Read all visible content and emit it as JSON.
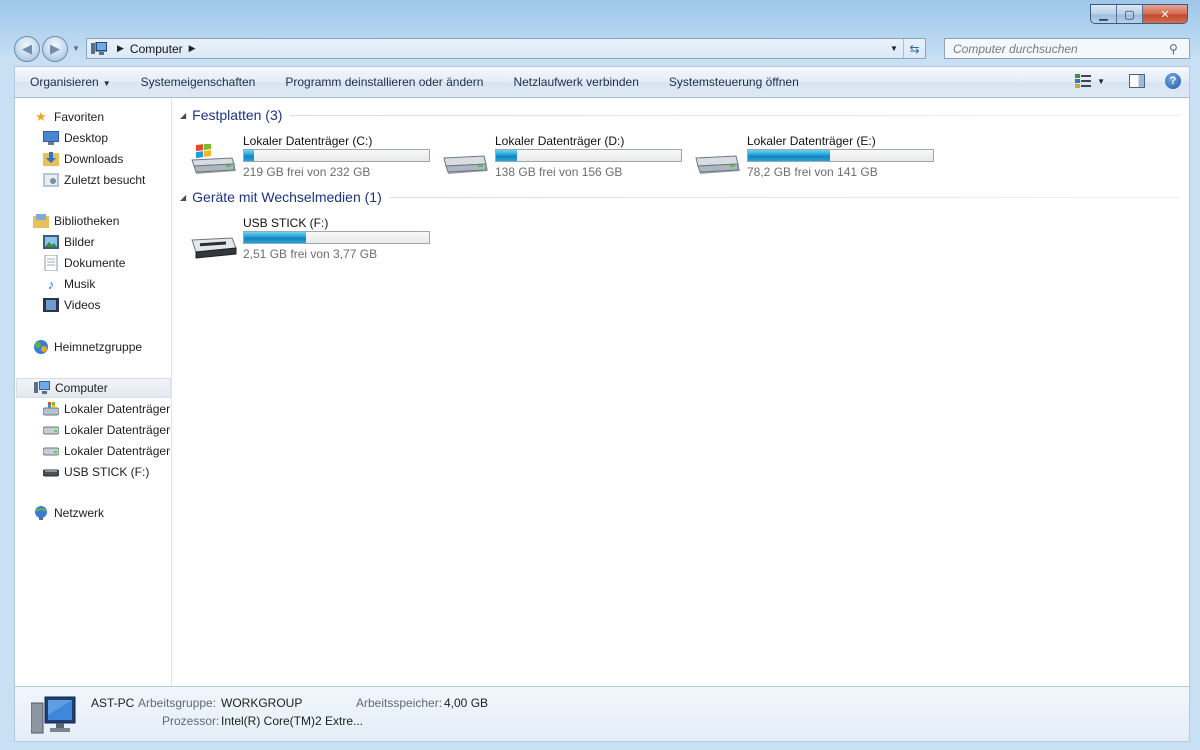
{
  "window": {
    "minimize_label": "▁",
    "maximize_label": "▢",
    "close_label": "✕"
  },
  "navigation": {
    "breadcrumb": "Computer",
    "search_placeholder": "Computer durchsuchen"
  },
  "toolbar": {
    "organize": "Organisieren",
    "system_properties": "Systemeigenschaften",
    "uninstall": "Programm deinstallieren oder ändern",
    "map_drive": "Netzlaufwerk verbinden",
    "control_panel": "Systemsteuerung öffnen"
  },
  "sidebar": {
    "favorites": "Favoriten",
    "desktop": "Desktop",
    "downloads": "Downloads",
    "recent": "Zuletzt besucht",
    "libraries": "Bibliotheken",
    "pictures": "Bilder",
    "documents": "Dokumente",
    "music": "Musik",
    "videos": "Videos",
    "homegroup": "Heimnetzgruppe",
    "computer": "Computer",
    "drive_c": "Lokaler Datenträger",
    "drive_d": "Lokaler Datenträger",
    "drive_e": "Lokaler Datenträger",
    "usb": "USB STICK (F:)",
    "network": "Netzwerk"
  },
  "groups": {
    "hard_disks": "Festplatten (3)",
    "removable": "Geräte mit Wechselmedien (1)"
  },
  "drives": [
    {
      "name": "Lokaler Datenträger (C:)",
      "free_text": "219 GB frei von 232 GB",
      "used_fraction": 0.056
    },
    {
      "name": "Lokaler Datenträger (D:)",
      "free_text": "138 GB frei von 156 GB",
      "used_fraction": 0.115
    },
    {
      "name": "Lokaler Datenträger (E:)",
      "free_text": "78,2 GB frei von 141 GB",
      "used_fraction": 0.445
    },
    {
      "name": "USB STICK (F:)",
      "free_text": "2,51 GB frei von 3,77 GB",
      "used_fraction": 0.334
    }
  ],
  "details": {
    "pc_name": "AST-PC",
    "workgroup_label": "Arbeitsgruppe:",
    "workgroup_value": "WORKGROUP",
    "memory_label": "Arbeitsspeicher:",
    "memory_value": "4,00 GB",
    "processor_label": "Prozessor:",
    "processor_value": "Intel(R) Core(TM)2 Extre..."
  },
  "colors": {
    "accent": "#26a0da",
    "group_title": "#1e3287"
  }
}
